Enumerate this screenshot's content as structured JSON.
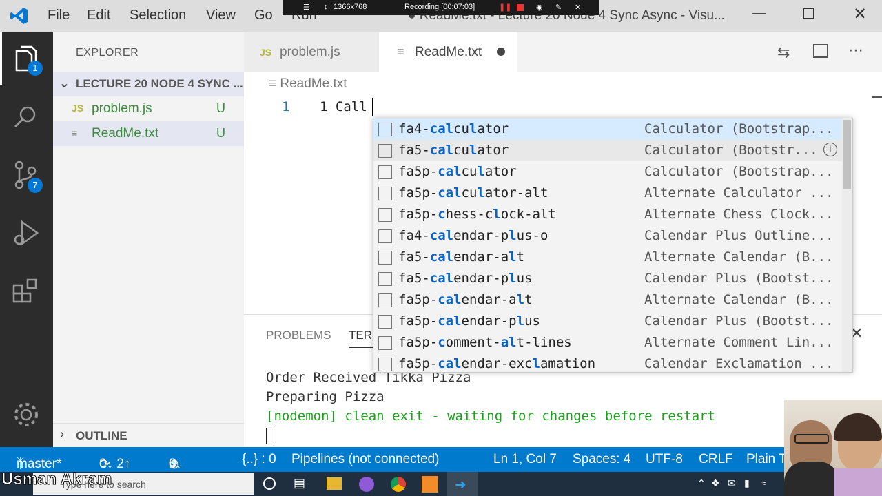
{
  "menu": {
    "items": [
      "File",
      "Edit",
      "Selection",
      "View",
      "Go",
      "Run"
    ]
  },
  "recorder": {
    "resolution": "1366x768",
    "status": "Recording [00:07:03]"
  },
  "window": {
    "title": "● ReadMe.txt - Lecture 20 Node 4 Sync Async - Visu..."
  },
  "activity": {
    "explorer_badge": "1",
    "scm_badge": "7"
  },
  "sidebar": {
    "header": "EXPLORER",
    "project": "LECTURE 20 NODE 4 SYNC ...",
    "files": [
      {
        "icon": "JS",
        "name": "problem.js",
        "status": "U"
      },
      {
        "icon": "≡",
        "name": "ReadMe.txt",
        "status": "U"
      }
    ],
    "outline": "OUTLINE"
  },
  "tabs": [
    {
      "icon": "JS",
      "label": "problem.js"
    },
    {
      "icon": "≡",
      "label": "ReadMe.txt"
    }
  ],
  "editor": {
    "breadcrumb": "ReadMe.txt",
    "line_number": "1",
    "line_text": "1 Call"
  },
  "suggest": {
    "items": [
      {
        "pre": "fa4-",
        "hl1": "cal",
        "mid": "cu",
        "hl2": "l",
        "post": "ator",
        "detail": "Calculator (Bootstrap..."
      },
      {
        "pre": "fa5-",
        "hl1": "cal",
        "mid": "cu",
        "hl2": "l",
        "post": "ator",
        "detail": "Calculator (Bootstr..."
      },
      {
        "pre": "fa5p-",
        "hl1": "cal",
        "mid": "cu",
        "hl2": "l",
        "post": "ator",
        "detail": "Calculator (Bootstrap..."
      },
      {
        "pre": "fa5p-",
        "hl1": "cal",
        "mid": "cu",
        "hl2": "l",
        "post": "ator-alt",
        "detail": "Alternate Calculator ..."
      },
      {
        "pre": "fa5p-",
        "hl1": "c",
        "mid": "hess-c",
        "hl2": "l",
        "post": "ock-alt",
        "detail": "Alternate Chess Clock..."
      },
      {
        "pre": "fa4-",
        "hl1": "cal",
        "mid": "endar-p",
        "hl2": "l",
        "post": "us-o",
        "detail": "Calendar Plus Outline..."
      },
      {
        "pre": "fa5-",
        "hl1": "cal",
        "mid": "endar-a",
        "hl2": "l",
        "post": "t",
        "detail": "Alternate Calendar (B..."
      },
      {
        "pre": "fa5-",
        "hl1": "cal",
        "mid": "endar-p",
        "hl2": "l",
        "post": "us",
        "detail": "Calendar Plus (Bootst..."
      },
      {
        "pre": "fa5p-",
        "hl1": "cal",
        "mid": "endar-a",
        "hl2": "l",
        "post": "t",
        "detail": "Alternate Calendar (B..."
      },
      {
        "pre": "fa5p-",
        "hl1": "cal",
        "mid": "endar-p",
        "hl2": "l",
        "post": "us",
        "detail": "Calendar Plus (Bootst..."
      },
      {
        "pre": "fa5p-",
        "hl1": "c",
        "mid": "omment-",
        "hl2": "al",
        "post": "t-lines",
        "detail": "Alternate Comment Lin..."
      },
      {
        "pre": "fa5p-",
        "hl1": "cal",
        "mid": "endar-exc",
        "hl2": "l",
        "post": "amation",
        "detail": "Calendar Exclamation ..."
      }
    ]
  },
  "panel": {
    "tabs": [
      "PROBLEMS",
      "TERM"
    ],
    "lines": [
      {
        "text": "Order Received Tikka Pizza",
        "color": "#333333"
      },
      {
        "text": "Preparing Pizza",
        "color": "#333333"
      },
      {
        "text": "[nodemon] clean exit - waiting for changes before restart",
        "color": "#19a319"
      }
    ]
  },
  "status": {
    "branch": "master*",
    "sync": "0↓ 2↑",
    "errors": "0",
    "warnings": "0",
    "braces": "{..} : 0",
    "pipelines": "Pipelines (not connected)",
    "position": "Ln 1, Col 7",
    "spaces": "Spaces: 4",
    "encoding": "UTF-8",
    "eol": "CRLF",
    "language": "Plain T"
  },
  "taskbar": {
    "search_placeholder": "Type here to search"
  },
  "watermark": "Usman Akram",
  "colors": {
    "accent": "#007acc",
    "activity_bg": "#2c2c2c",
    "highlight": "#0a64c6",
    "untracked": "#3d8b3d"
  }
}
